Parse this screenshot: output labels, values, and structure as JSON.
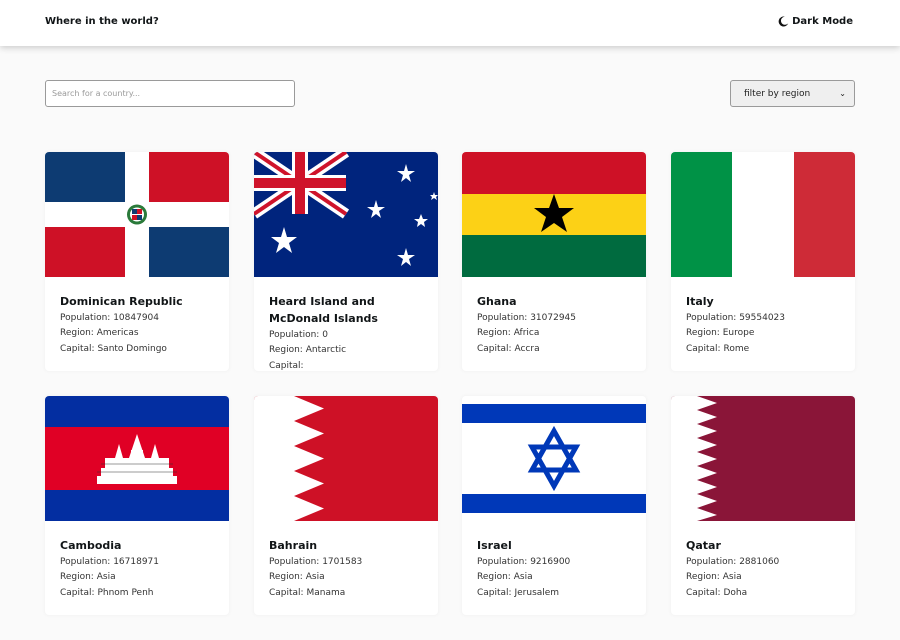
{
  "header": {
    "title": "Where in the world?",
    "theme_toggle_label": "Dark Mode",
    "theme_icon": "moon-icon"
  },
  "search": {
    "placeholder": "Search for a country..."
  },
  "filter": {
    "selected": "filter by region",
    "chevron_icon": "chevron-down-icon"
  },
  "labels": {
    "population": "Population:",
    "region": "Region:",
    "capital": "Capital:"
  },
  "countries": [
    {
      "name": "Dominican Republic",
      "population": "10847904",
      "region": "Americas",
      "capital": "Santo Domingo",
      "flag_icon": "dominican-republic-flag"
    },
    {
      "name": "Heard Island and McDonald Islands",
      "population": "0",
      "region": "Antarctic",
      "capital": "",
      "flag_icon": "heard-island-flag"
    },
    {
      "name": "Ghana",
      "population": "31072945",
      "region": "Africa",
      "capital": "Accra",
      "flag_icon": "ghana-flag"
    },
    {
      "name": "Italy",
      "population": "59554023",
      "region": "Europe",
      "capital": "Rome",
      "flag_icon": "italy-flag"
    },
    {
      "name": "Cambodia",
      "population": "16718971",
      "region": "Asia",
      "capital": "Phnom Penh",
      "flag_icon": "cambodia-flag"
    },
    {
      "name": "Bahrain",
      "population": "1701583",
      "region": "Asia",
      "capital": "Manama",
      "flag_icon": "bahrain-flag"
    },
    {
      "name": "Israel",
      "population": "9216900",
      "region": "Asia",
      "capital": "Jerusalem",
      "flag_icon": "israel-flag"
    },
    {
      "name": "Qatar",
      "population": "2881060",
      "region": "Asia",
      "capital": "Doha",
      "flag_icon": "qatar-flag"
    }
  ],
  "colors": {
    "background": "#fafafa",
    "text": "#111517",
    "card": "#ffffff"
  }
}
